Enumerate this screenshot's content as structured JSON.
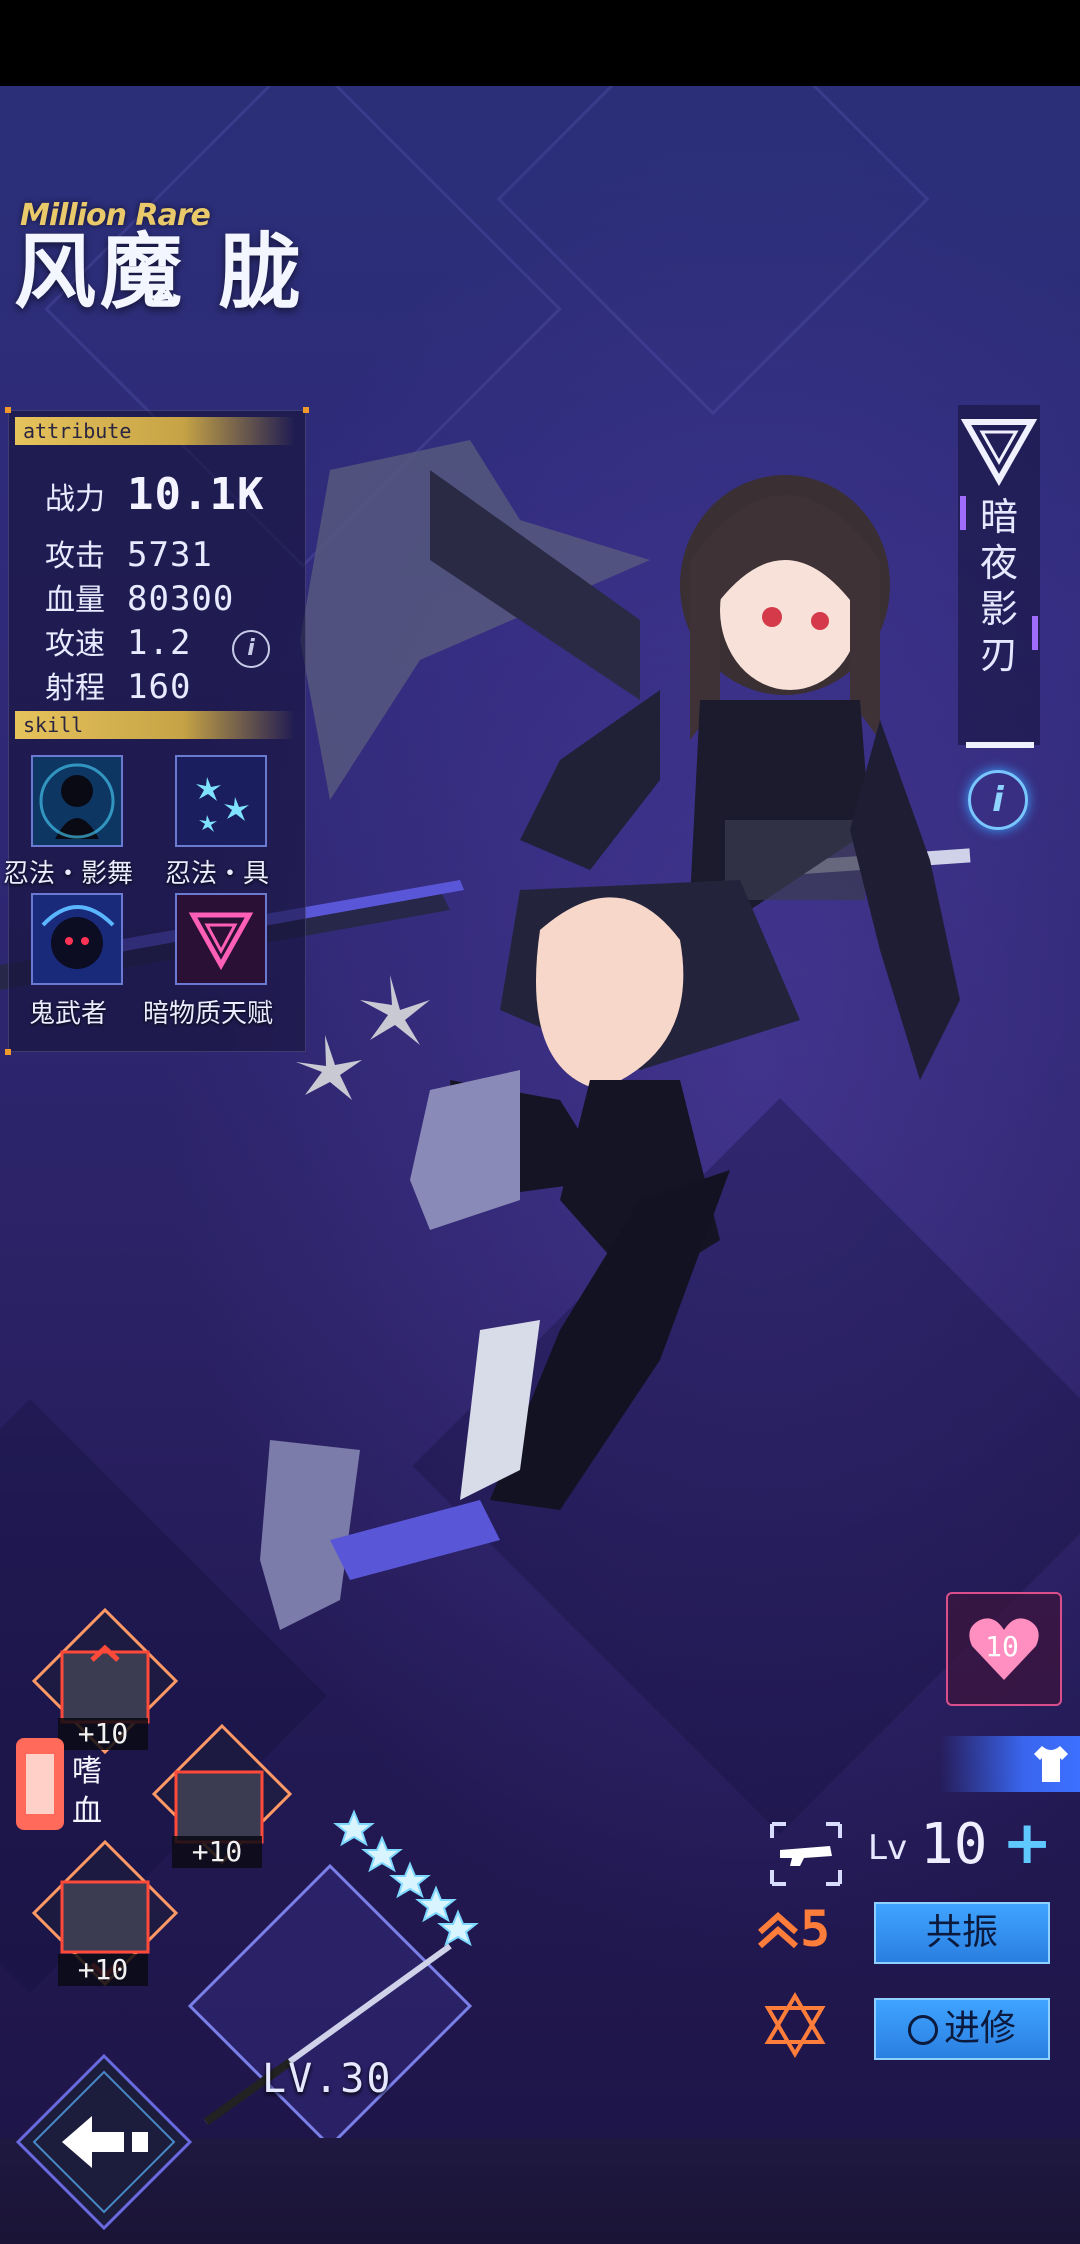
{
  "character": {
    "rarity": "Million Rare",
    "name": "风魔 胧"
  },
  "attribute": {
    "header": "attribute",
    "stats": [
      {
        "label": "战力",
        "value": "10.1K"
      },
      {
        "label": "攻击",
        "value": "5731"
      },
      {
        "label": "血量",
        "value": "80300"
      },
      {
        "label": "攻速",
        "value": "1.2"
      },
      {
        "label": "射程",
        "value": "160"
      }
    ]
  },
  "skill": {
    "header": "skill",
    "items": [
      {
        "label": "忍法・影舞",
        "icon": "shadow-figure-icon"
      },
      {
        "label": "忍法・具",
        "icon": "shuriken-icon"
      },
      {
        "label": "鬼武者",
        "icon": "oni-mask-icon"
      },
      {
        "label": "暗物质天赋",
        "icon": "dark-triangle-icon"
      }
    ]
  },
  "class_tag": {
    "chars": [
      "暗",
      "夜",
      "影",
      "刃"
    ]
  },
  "affection": {
    "value": "10"
  },
  "equipment": {
    "slots": [
      {
        "badge": "+10"
      },
      {
        "badge": "+10"
      },
      {
        "badge": "+10"
      }
    ],
    "set_label": [
      "嗜",
      "血"
    ]
  },
  "weapon": {
    "level": "LV.30",
    "stars": 5
  },
  "upgrade": {
    "lv_prefix": "Lv",
    "lv_value": "10",
    "plus": "+",
    "star_level": "5",
    "resonance_button": "共振",
    "advance_button": "进修"
  },
  "colors": {
    "accent_gold": "#e6c35c",
    "accent_blue": "#3fa4ff",
    "accent_pink": "#d94f8c",
    "accent_orange": "#ff7d3a"
  }
}
